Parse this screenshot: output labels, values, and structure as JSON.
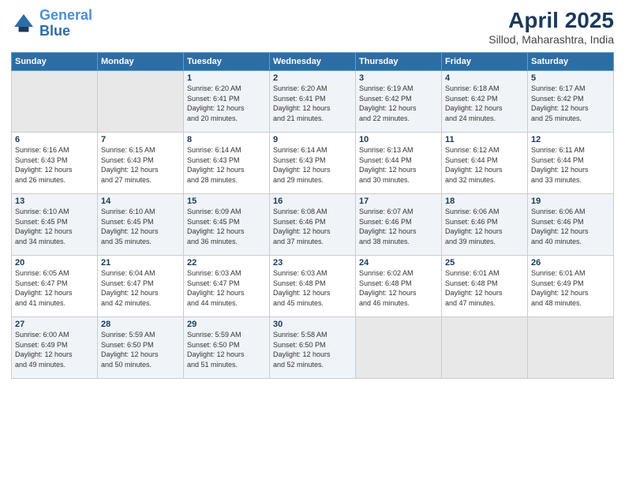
{
  "header": {
    "logo_line1": "General",
    "logo_line2": "Blue",
    "title": "April 2025",
    "location": "Sillod, Maharashtra, India"
  },
  "days_of_week": [
    "Sunday",
    "Monday",
    "Tuesday",
    "Wednesday",
    "Thursday",
    "Friday",
    "Saturday"
  ],
  "weeks": [
    [
      {
        "day": "",
        "info": ""
      },
      {
        "day": "",
        "info": ""
      },
      {
        "day": "1",
        "info": "Sunrise: 6:20 AM\nSunset: 6:41 PM\nDaylight: 12 hours\nand 20 minutes."
      },
      {
        "day": "2",
        "info": "Sunrise: 6:20 AM\nSunset: 6:41 PM\nDaylight: 12 hours\nand 21 minutes."
      },
      {
        "day": "3",
        "info": "Sunrise: 6:19 AM\nSunset: 6:42 PM\nDaylight: 12 hours\nand 22 minutes."
      },
      {
        "day": "4",
        "info": "Sunrise: 6:18 AM\nSunset: 6:42 PM\nDaylight: 12 hours\nand 24 minutes."
      },
      {
        "day": "5",
        "info": "Sunrise: 6:17 AM\nSunset: 6:42 PM\nDaylight: 12 hours\nand 25 minutes."
      }
    ],
    [
      {
        "day": "6",
        "info": "Sunrise: 6:16 AM\nSunset: 6:43 PM\nDaylight: 12 hours\nand 26 minutes."
      },
      {
        "day": "7",
        "info": "Sunrise: 6:15 AM\nSunset: 6:43 PM\nDaylight: 12 hours\nand 27 minutes."
      },
      {
        "day": "8",
        "info": "Sunrise: 6:14 AM\nSunset: 6:43 PM\nDaylight: 12 hours\nand 28 minutes."
      },
      {
        "day": "9",
        "info": "Sunrise: 6:14 AM\nSunset: 6:43 PM\nDaylight: 12 hours\nand 29 minutes."
      },
      {
        "day": "10",
        "info": "Sunrise: 6:13 AM\nSunset: 6:44 PM\nDaylight: 12 hours\nand 30 minutes."
      },
      {
        "day": "11",
        "info": "Sunrise: 6:12 AM\nSunset: 6:44 PM\nDaylight: 12 hours\nand 32 minutes."
      },
      {
        "day": "12",
        "info": "Sunrise: 6:11 AM\nSunset: 6:44 PM\nDaylight: 12 hours\nand 33 minutes."
      }
    ],
    [
      {
        "day": "13",
        "info": "Sunrise: 6:10 AM\nSunset: 6:45 PM\nDaylight: 12 hours\nand 34 minutes."
      },
      {
        "day": "14",
        "info": "Sunrise: 6:10 AM\nSunset: 6:45 PM\nDaylight: 12 hours\nand 35 minutes."
      },
      {
        "day": "15",
        "info": "Sunrise: 6:09 AM\nSunset: 6:45 PM\nDaylight: 12 hours\nand 36 minutes."
      },
      {
        "day": "16",
        "info": "Sunrise: 6:08 AM\nSunset: 6:46 PM\nDaylight: 12 hours\nand 37 minutes."
      },
      {
        "day": "17",
        "info": "Sunrise: 6:07 AM\nSunset: 6:46 PM\nDaylight: 12 hours\nand 38 minutes."
      },
      {
        "day": "18",
        "info": "Sunrise: 6:06 AM\nSunset: 6:46 PM\nDaylight: 12 hours\nand 39 minutes."
      },
      {
        "day": "19",
        "info": "Sunrise: 6:06 AM\nSunset: 6:46 PM\nDaylight: 12 hours\nand 40 minutes."
      }
    ],
    [
      {
        "day": "20",
        "info": "Sunrise: 6:05 AM\nSunset: 6:47 PM\nDaylight: 12 hours\nand 41 minutes."
      },
      {
        "day": "21",
        "info": "Sunrise: 6:04 AM\nSunset: 6:47 PM\nDaylight: 12 hours\nand 42 minutes."
      },
      {
        "day": "22",
        "info": "Sunrise: 6:03 AM\nSunset: 6:47 PM\nDaylight: 12 hours\nand 44 minutes."
      },
      {
        "day": "23",
        "info": "Sunrise: 6:03 AM\nSunset: 6:48 PM\nDaylight: 12 hours\nand 45 minutes."
      },
      {
        "day": "24",
        "info": "Sunrise: 6:02 AM\nSunset: 6:48 PM\nDaylight: 12 hours\nand 46 minutes."
      },
      {
        "day": "25",
        "info": "Sunrise: 6:01 AM\nSunset: 6:48 PM\nDaylight: 12 hours\nand 47 minutes."
      },
      {
        "day": "26",
        "info": "Sunrise: 6:01 AM\nSunset: 6:49 PM\nDaylight: 12 hours\nand 48 minutes."
      }
    ],
    [
      {
        "day": "27",
        "info": "Sunrise: 6:00 AM\nSunset: 6:49 PM\nDaylight: 12 hours\nand 49 minutes."
      },
      {
        "day": "28",
        "info": "Sunrise: 5:59 AM\nSunset: 6:50 PM\nDaylight: 12 hours\nand 50 minutes."
      },
      {
        "day": "29",
        "info": "Sunrise: 5:59 AM\nSunset: 6:50 PM\nDaylight: 12 hours\nand 51 minutes."
      },
      {
        "day": "30",
        "info": "Sunrise: 5:58 AM\nSunset: 6:50 PM\nDaylight: 12 hours\nand 52 minutes."
      },
      {
        "day": "",
        "info": ""
      },
      {
        "day": "",
        "info": ""
      },
      {
        "day": "",
        "info": ""
      }
    ]
  ]
}
